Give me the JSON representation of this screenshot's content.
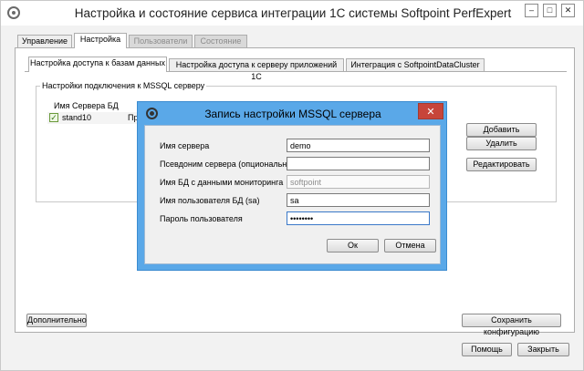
{
  "window": {
    "title": "Настройка и состояние сервиса интеграции 1С системы Softpoint PerfExpert",
    "controls": {
      "minimize": "–",
      "maximize": "□",
      "close": "✕"
    }
  },
  "main_tabs": [
    {
      "label": "Управление"
    },
    {
      "label": "Настройка"
    },
    {
      "label": "Пользователи"
    },
    {
      "label": "Состояние"
    }
  ],
  "sub_tabs": [
    {
      "label": "Настройка доступа к базам данных"
    },
    {
      "label": "Настройка доступа к серверу приложений 1С"
    },
    {
      "label": "Интеграция с SoftpointDataCluster"
    }
  ],
  "group": {
    "title": "Настройки подключения к MSSQL серверу"
  },
  "grid": {
    "columns": [
      "Имя Сервера БД"
    ],
    "rows": [
      {
        "server": "stand10",
        "alias_partial": "Пр"
      }
    ]
  },
  "side_buttons": {
    "add": "Добавить",
    "delete": "Удалить",
    "edit": "Редактировать"
  },
  "bottom_buttons": {
    "advanced": "Дополнительно",
    "save_config": "Сохранить конфигурацию",
    "help": "Помощь",
    "close": "Закрыть"
  },
  "dialog": {
    "title": "Запись настройки MSSQL сервера",
    "fields": [
      {
        "label": "Имя сервера",
        "value": "demo",
        "placeholder": "",
        "disabled": false
      },
      {
        "label": "Псевдоним сервера (опционально)",
        "value": "",
        "placeholder": "",
        "disabled": false
      },
      {
        "label": "Имя БД с данными мониторинга",
        "value": "softpoint",
        "placeholder": "",
        "disabled": true
      },
      {
        "label": "Имя пользователя БД (sa)",
        "value": "sa",
        "placeholder": "",
        "disabled": false
      },
      {
        "label": "Пароль пользователя",
        "value": "password",
        "placeholder": "",
        "disabled": false
      }
    ],
    "ok": "Ок",
    "cancel": "Отмена",
    "close": "✕"
  },
  "colors": {
    "dialog_frame": "#5aa8e8",
    "dialog_close": "#c7453a",
    "window_bg": "#f2f2f2"
  }
}
